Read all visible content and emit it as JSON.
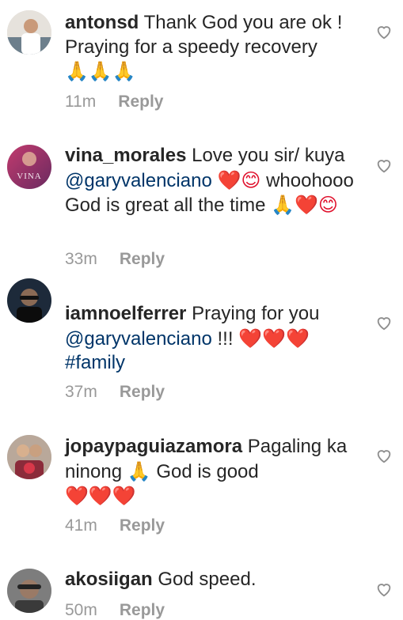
{
  "comments": [
    {
      "username": "antonsd",
      "text": "Thank God you are ok ! Praying for a speedy recovery",
      "emojis": "🙏🙏🙏",
      "time": "11m",
      "reply_label": "Reply"
    },
    {
      "username": "vina_morales",
      "text_1": "Love you sir/ kuya",
      "mention": "@garyvalenciano",
      "emojis_1": "❤️😊",
      "text_2": "whoohooo God is great all the time",
      "emojis_2": "🙏❤️😊",
      "time": "33m",
      "reply_label": "Reply",
      "avatar_text": "VINA"
    },
    {
      "username": "iamnoelferrer",
      "text_1": "Praying for you",
      "mention": "@garyvalenciano",
      "text_2": "!!!",
      "emojis": "❤️❤️❤️",
      "hashtag": "#family",
      "time": "37m",
      "reply_label": "Reply"
    },
    {
      "username": "jopaypaguiazamora",
      "text_1": "Pagaling ka ninong",
      "emojis_1": "🙏",
      "text_2": "God is good",
      "emojis_2": "❤️❤️❤️",
      "time": "41m",
      "reply_label": "Reply"
    },
    {
      "username": "akosiigan",
      "text": "God speed.",
      "time": "50m",
      "reply_label": "Reply"
    }
  ]
}
